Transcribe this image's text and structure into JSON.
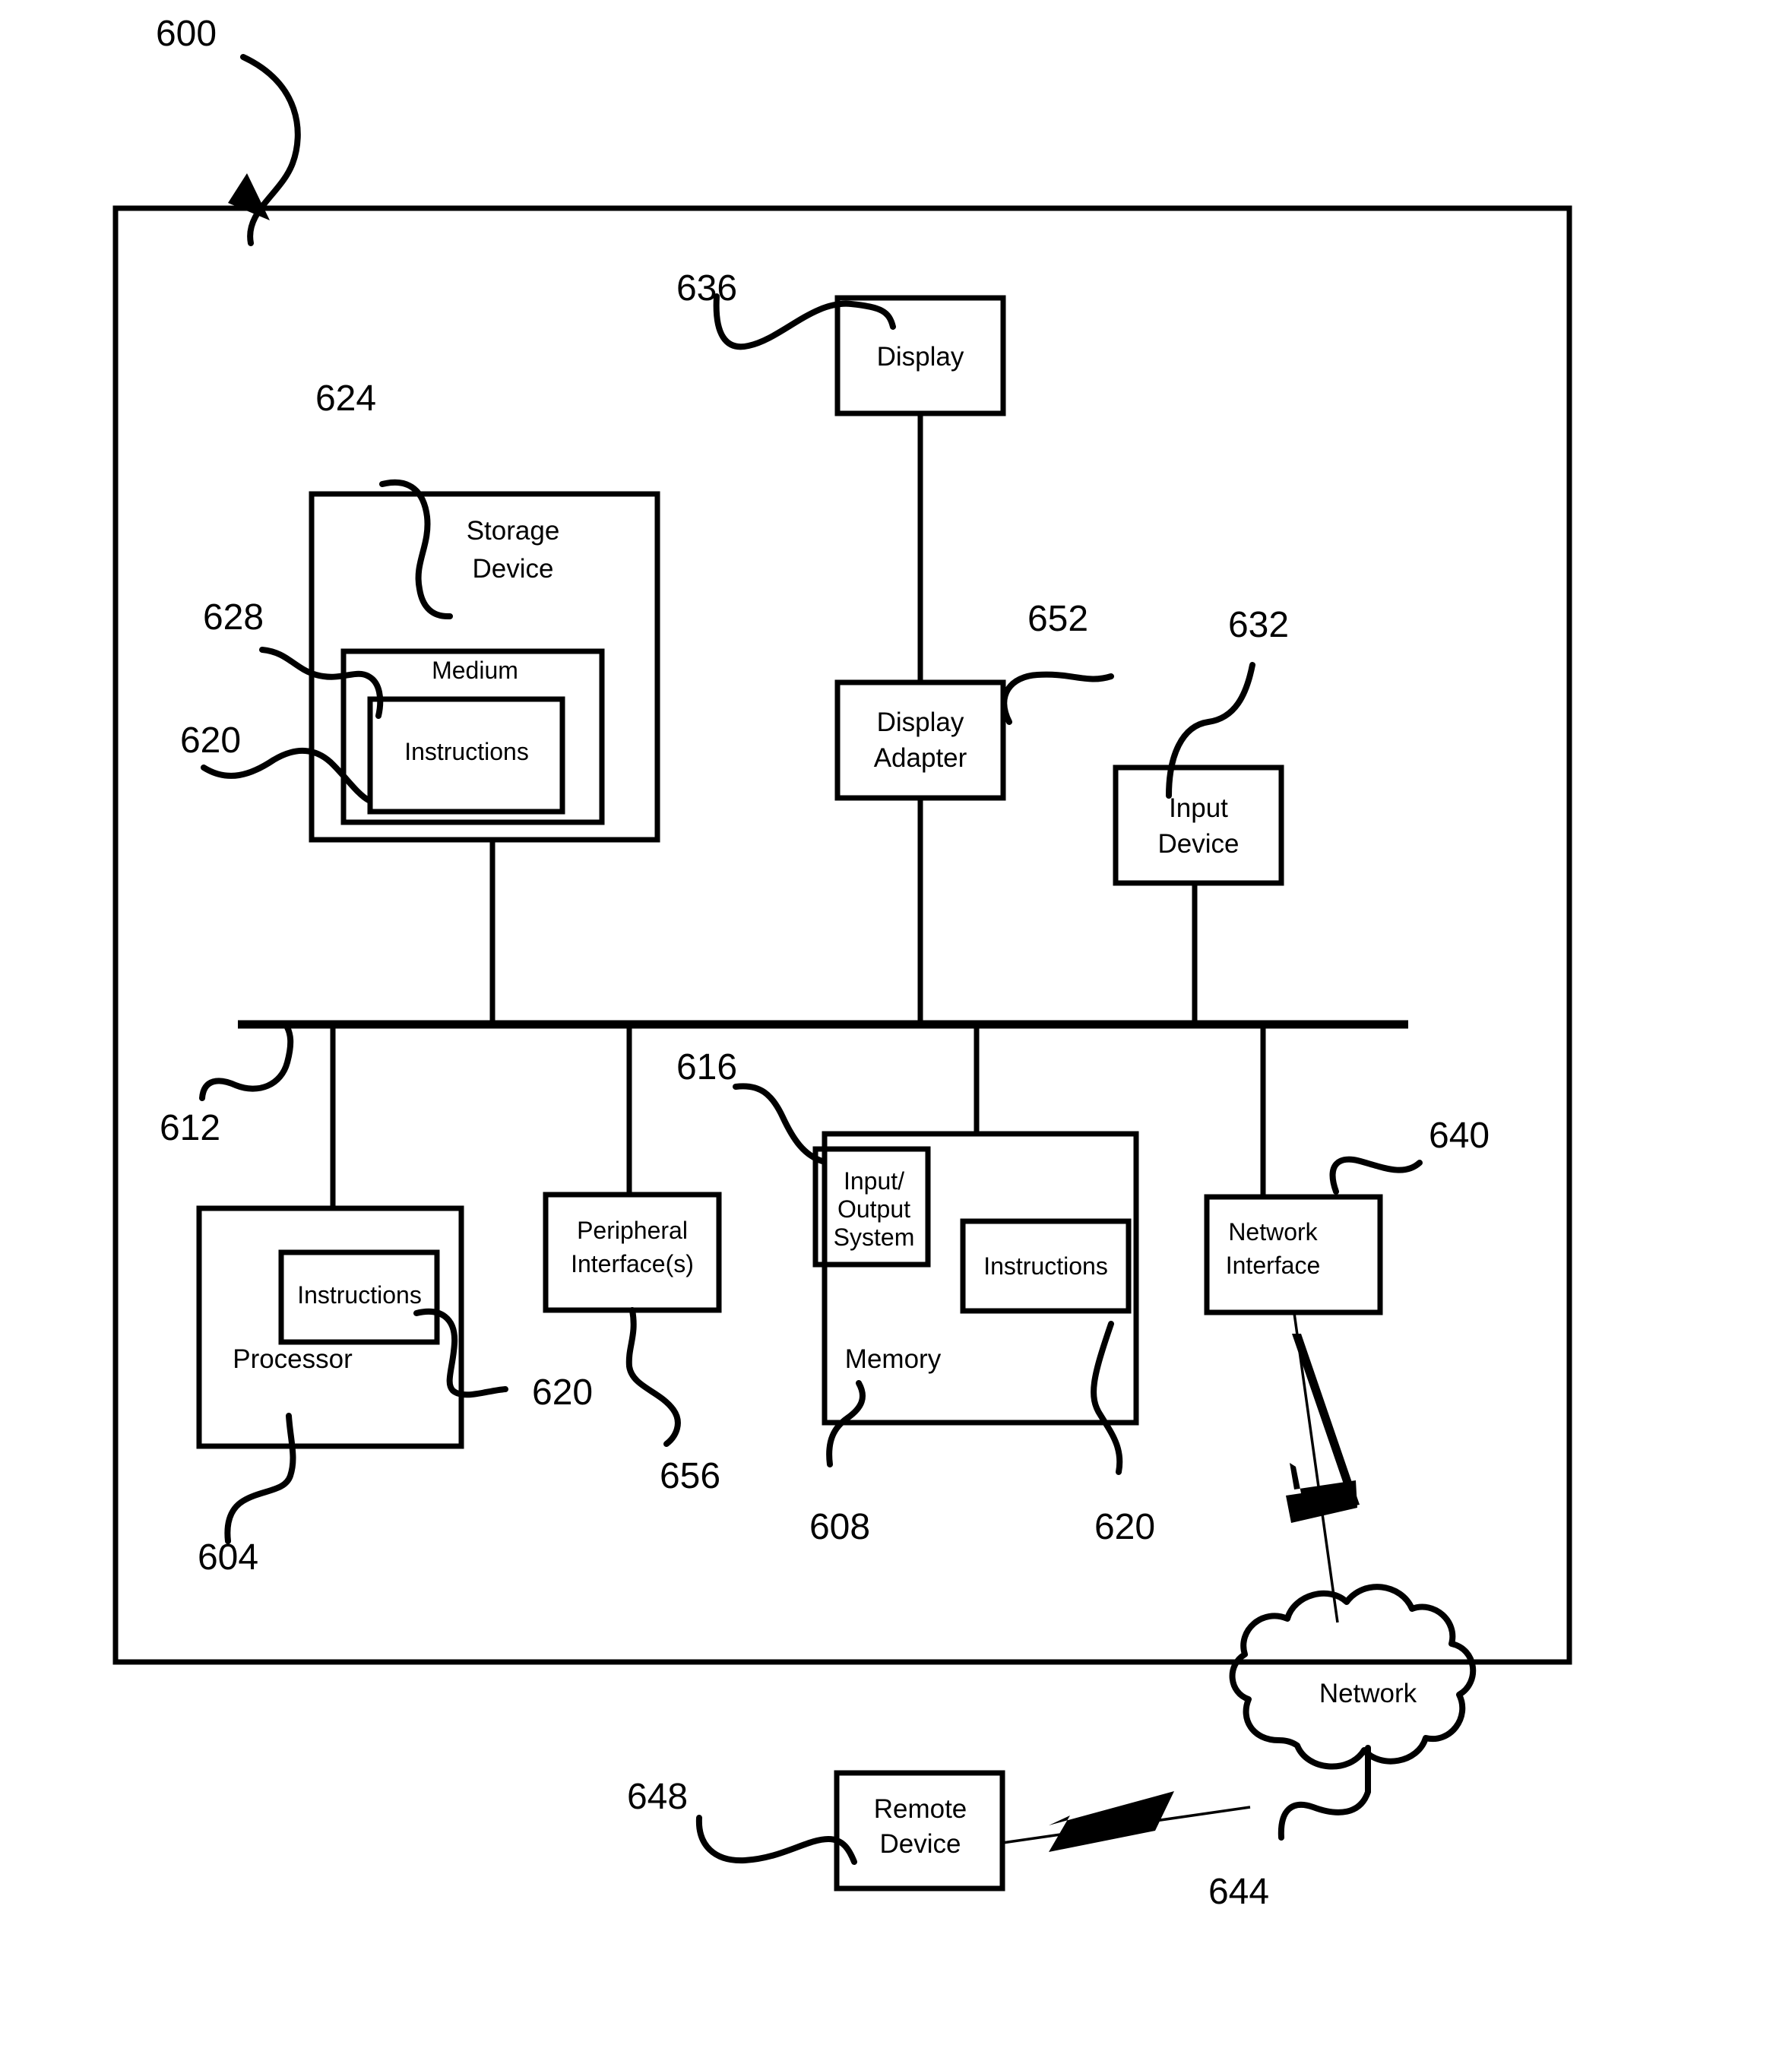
{
  "figure": {
    "system_reference": "600",
    "blocks": {
      "storage_device": {
        "label_line1": "Storage",
        "label_line2": "Device",
        "ref": "624"
      },
      "medium": {
        "label": "Medium",
        "ref": "628"
      },
      "storage_instructions": {
        "label": "Instructions",
        "ref": "620"
      },
      "display": {
        "label": "Display",
        "ref": "636"
      },
      "display_adapter": {
        "label_line1": "Display",
        "label_line2": "Adapter",
        "ref": "652"
      },
      "input_device": {
        "label_line1": "Input",
        "label_line2": "Device",
        "ref": "632"
      },
      "bus": {
        "ref": "612"
      },
      "processor": {
        "label": "Processor",
        "ref": "604"
      },
      "processor_instructions": {
        "label": "Instructions",
        "ref": "620"
      },
      "peripheral_interfaces": {
        "label_line1": "Peripheral",
        "label_line2": "Interface(s)",
        "ref": "656"
      },
      "memory": {
        "label": "Memory",
        "ref": "608"
      },
      "io_system": {
        "label_line1": "Input/",
        "label_line2": "Output",
        "label_line3": "System",
        "ref": "616"
      },
      "memory_instructions": {
        "label": "Instructions",
        "ref": "620"
      },
      "network_interface": {
        "label_line1": "Network",
        "label_line2": "Interface",
        "ref": "640"
      },
      "network_cloud": {
        "label": "Network",
        "ref": "644"
      },
      "remote_device": {
        "label_line1": "Remote",
        "label_line2": "Device",
        "ref": "648"
      }
    },
    "colors": {
      "stroke": "#000000",
      "background": "#ffffff"
    }
  }
}
